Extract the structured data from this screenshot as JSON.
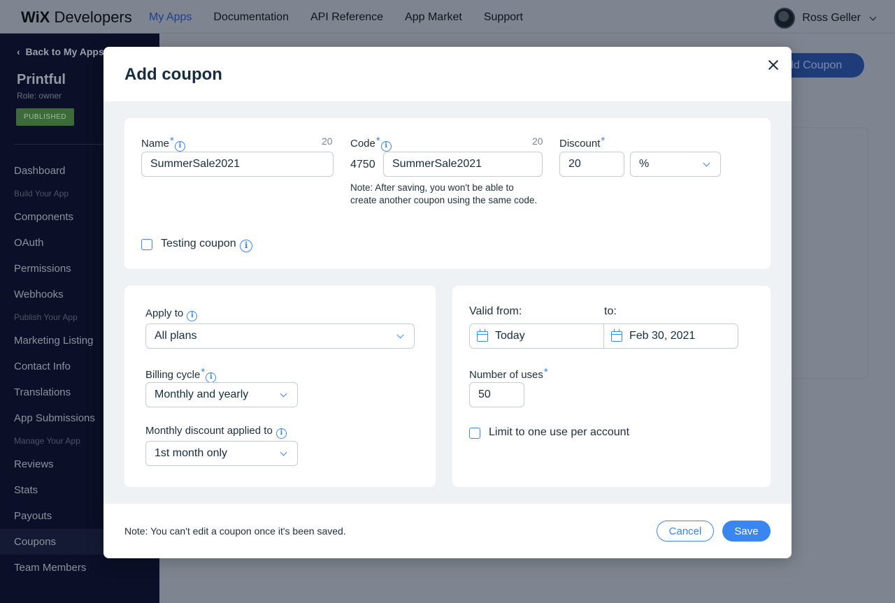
{
  "topbar": {
    "logo_wix": "WiX",
    "logo_rest": "Developers",
    "nav": [
      "My Apps",
      "Documentation",
      "API Reference",
      "App Market",
      "Support"
    ],
    "user_name": "Ross Geller"
  },
  "sidebar": {
    "back_label": "Back to My Apps",
    "app_name": "Printful",
    "role": "Role: owner",
    "status_badge": "PUBLISHED",
    "items": {
      "dashboard": "Dashboard",
      "sec_build": "Build Your App",
      "components": "Components",
      "oauth": "OAuth",
      "permissions": "Permissions",
      "webhooks": "Webhooks",
      "sec_publish": "Publish Your App",
      "marketing": "Marketing Listing",
      "contact": "Contact Info",
      "translations": "Translations",
      "submissions": "App Submissions",
      "sec_manage": "Manage Your App",
      "reviews": "Reviews",
      "stats": "Stats",
      "payouts": "Payouts",
      "coupons": "Coupons",
      "team": "Team Members"
    }
  },
  "background": {
    "add_coupon_button": "dd Coupon"
  },
  "modal": {
    "title": "Add coupon",
    "name": {
      "label": "Name",
      "count": "20",
      "value": "SummerSale2021"
    },
    "code": {
      "label": "Code",
      "count": "20",
      "prefix": "4750",
      "value": "SummerSale2021",
      "note": "Note: After saving, you won't be able to create another coupon using the same code."
    },
    "discount": {
      "label": "Discount",
      "value": "20",
      "unit": "%"
    },
    "testing_coupon": {
      "label": "Testing coupon",
      "checked": false
    },
    "apply_to": {
      "label": "Apply to",
      "value": "All plans"
    },
    "billing_cycle": {
      "label": "Billing cycle",
      "value": "Monthly and yearly"
    },
    "monthly_discount": {
      "label": "Monthly discount applied to",
      "value": "1st month only"
    },
    "valid_from": {
      "label": "Valid from:",
      "value": "Today"
    },
    "valid_to": {
      "label": "to:",
      "value": "Feb 30, 2021"
    },
    "uses": {
      "label": "Number of uses",
      "value": "50"
    },
    "limit_one": {
      "label": "Limit to one use per account",
      "checked": false
    },
    "footer_note": "Note: You can't edit a coupon once it's been saved.",
    "cancel_label": "Cancel",
    "save_label": "Save",
    "info_glyph": "i",
    "required_glyph": "*"
  },
  "colors": {
    "accent": "#3a86f0",
    "sidebar_bg": "#0b0f27",
    "overlay_bg": "#7f8590"
  }
}
